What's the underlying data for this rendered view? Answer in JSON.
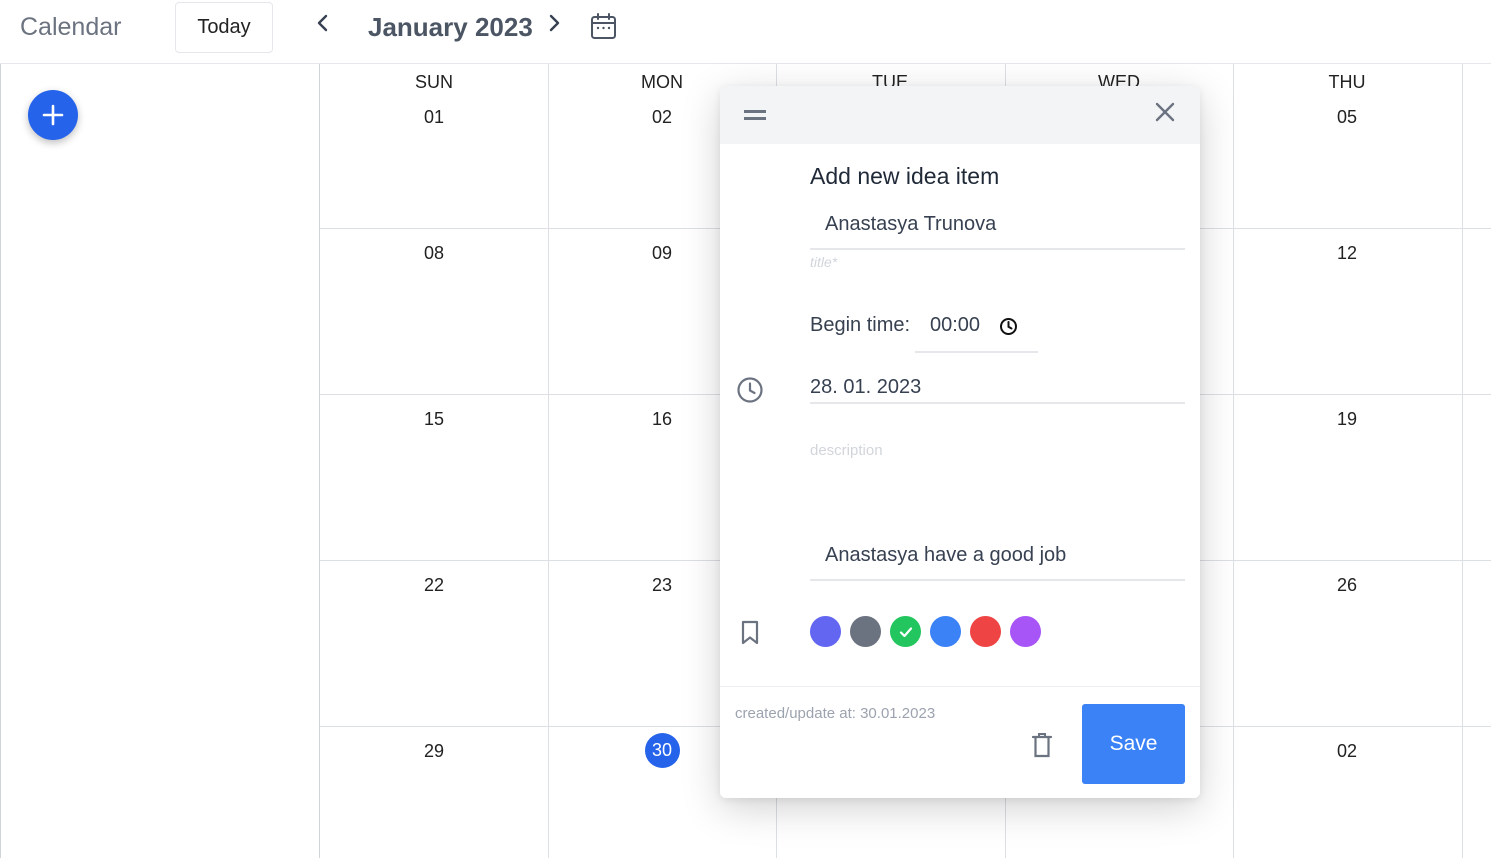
{
  "header": {
    "app_title": "Calendar",
    "today_label": "Today",
    "month_title": "January 2023"
  },
  "calendar": {
    "day_names": [
      "SUN",
      "MON",
      "TUE",
      "WED",
      "THU"
    ],
    "weeks": [
      [
        "01",
        "02",
        "",
        "",
        "05"
      ],
      [
        "08",
        "09",
        "",
        "",
        "12"
      ],
      [
        "15",
        "16",
        "",
        "",
        "19"
      ],
      [
        "22",
        "23",
        "",
        "",
        "26"
      ],
      [
        "29",
        "30",
        "",
        "",
        "02"
      ]
    ],
    "today_date": "30"
  },
  "modal": {
    "title": "Add new idea item",
    "title_value": "Anastasya Trunova",
    "title_hint": "title*",
    "begin_label": "Begin time:",
    "begin_time": "00:00",
    "date_value": "28. 01. 2023",
    "description_hint": "description",
    "description_value": "Anastasya have a good job",
    "colors": [
      "#6366f1",
      "#6b7280",
      "#22c55e",
      "#3b82f6",
      "#ef4444",
      "#a855f7"
    ],
    "selected_color": "#22c55e",
    "meta": "created/update at: 30.01.2023",
    "save_label": "Save"
  },
  "icons": {
    "prev": "chevron-left-icon",
    "next": "chevron-right-icon",
    "calendar": "calendar-icon",
    "add": "plus-icon",
    "drag": "drag-handle-icon",
    "close": "close-icon",
    "time": "clock-icon",
    "bookmark": "bookmark-icon",
    "delete": "trash-icon"
  },
  "accent": "#2563eb"
}
